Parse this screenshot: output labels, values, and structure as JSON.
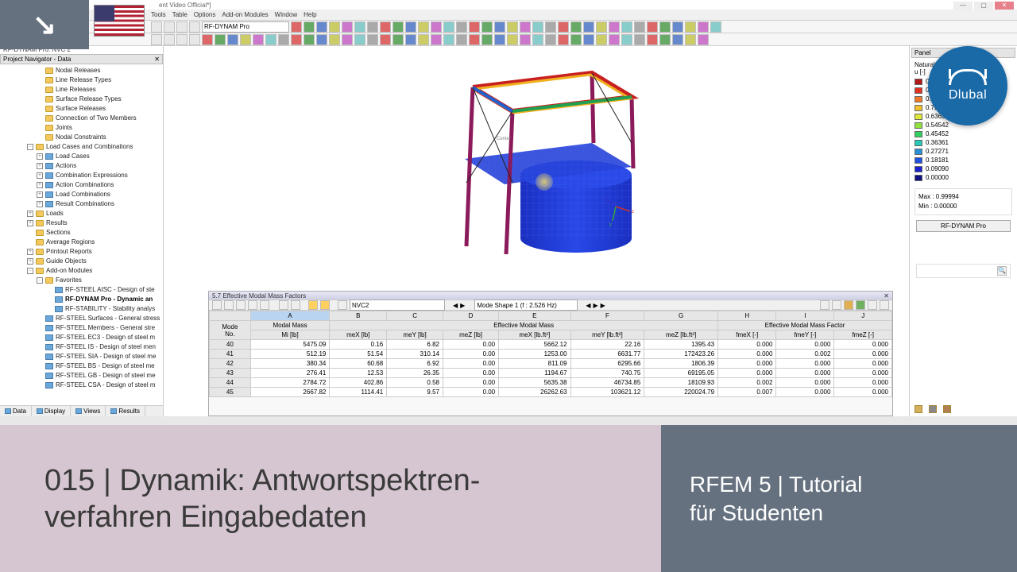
{
  "window": {
    "title_suffix": "ent Video Official*]"
  },
  "menus": [
    "Tools",
    "Table",
    "Options",
    "Add-on Modules",
    "Window",
    "Help"
  ],
  "toolbars": {
    "module_dropdown": "RF-DYNAM Pro",
    "icons_row1_count": 34,
    "icons_row2_count": 40
  },
  "navigator": {
    "context_title": "RF-DYNAM Pro: NVC 2",
    "panel_title": "Project Navigator - Data",
    "items": [
      {
        "ind": 40,
        "icon": "folder",
        "label": "Nodal Releases"
      },
      {
        "ind": 40,
        "icon": "folder",
        "label": "Line Release Types"
      },
      {
        "ind": 40,
        "icon": "folder",
        "label": "Line Releases"
      },
      {
        "ind": 40,
        "icon": "folder",
        "label": "Surface Release Types"
      },
      {
        "ind": 40,
        "icon": "folder",
        "label": "Surface Releases"
      },
      {
        "ind": 40,
        "icon": "folder",
        "label": "Connection of Two Members"
      },
      {
        "ind": 40,
        "icon": "folder",
        "label": "Joints"
      },
      {
        "ind": 40,
        "icon": "folder",
        "label": "Nodal Constraints"
      },
      {
        "ind": 28,
        "exp": "-",
        "icon": "folder",
        "label": "Load Cases and Combinations"
      },
      {
        "ind": 40,
        "exp": "+",
        "icon": "sq",
        "label": "Load Cases"
      },
      {
        "ind": 40,
        "exp": "+",
        "icon": "sq",
        "label": "Actions"
      },
      {
        "ind": 40,
        "exp": "+",
        "icon": "sq",
        "label": "Combination Expressions"
      },
      {
        "ind": 40,
        "exp": "+",
        "icon": "sq",
        "label": "Action Combinations"
      },
      {
        "ind": 40,
        "exp": "+",
        "icon": "sq",
        "label": "Load Combinations"
      },
      {
        "ind": 40,
        "exp": "+",
        "icon": "sq",
        "label": "Result Combinations"
      },
      {
        "ind": 28,
        "exp": "+",
        "icon": "folder",
        "label": "Loads"
      },
      {
        "ind": 28,
        "exp": "+",
        "icon": "folder",
        "label": "Results"
      },
      {
        "ind": 28,
        "icon": "folder",
        "label": "Sections"
      },
      {
        "ind": 28,
        "icon": "folder",
        "label": "Average Regions"
      },
      {
        "ind": 28,
        "exp": "+",
        "icon": "folder",
        "label": "Printout Reports"
      },
      {
        "ind": 28,
        "exp": "+",
        "icon": "folder",
        "label": "Guide Objects"
      },
      {
        "ind": 28,
        "exp": "-",
        "icon": "folder",
        "label": "Add-on Modules"
      },
      {
        "ind": 40,
        "exp": "-",
        "icon": "folder",
        "label": "Favorites"
      },
      {
        "ind": 52,
        "icon": "sq",
        "label": "RF-STEEL AISC - Design of ste"
      },
      {
        "ind": 52,
        "icon": "sq",
        "label": "RF-DYNAM Pro - Dynamic an",
        "bold": true
      },
      {
        "ind": 52,
        "icon": "sq",
        "label": "RF-STABILITY - Stability analys"
      },
      {
        "ind": 40,
        "icon": "sq",
        "label": "RF-STEEL Surfaces - General stress"
      },
      {
        "ind": 40,
        "icon": "sq",
        "label": "RF-STEEL Members - General stre"
      },
      {
        "ind": 40,
        "icon": "sq",
        "label": "RF-STEEL EC3 - Design of steel m"
      },
      {
        "ind": 40,
        "icon": "sq",
        "label": "RF-STEEL IS - Design of steel men"
      },
      {
        "ind": 40,
        "icon": "sq",
        "label": "RF-STEEL SIA - Design of steel me"
      },
      {
        "ind": 40,
        "icon": "sq",
        "label": "RF-STEEL BS - Design of steel me"
      },
      {
        "ind": 40,
        "icon": "sq",
        "label": "RF-STEEL GB - Design of steel me"
      },
      {
        "ind": 40,
        "icon": "sq",
        "label": "RF-STEEL CSA - Design of steel m"
      }
    ],
    "tabs": [
      "Data",
      "Display",
      "Views",
      "Results"
    ]
  },
  "legend": {
    "panel_label": "Panel",
    "title": "Natural vibration",
    "unit": "u [-]",
    "entries": [
      {
        "color": "#b21818",
        "value": "0.99994"
      },
      {
        "color": "#e03020",
        "value": "0.90903"
      },
      {
        "color": "#f07828",
        "value": "0.81813"
      },
      {
        "color": "#f0c030",
        "value": "0.72723"
      },
      {
        "color": "#e0e838",
        "value": "0.63632"
      },
      {
        "color": "#90e040",
        "value": "0.54542"
      },
      {
        "color": "#30d060",
        "value": "0.45452"
      },
      {
        "color": "#28c8b8",
        "value": "0.36361"
      },
      {
        "color": "#2890d8",
        "value": "0.27271"
      },
      {
        "color": "#2050e0",
        "value": "0.18181"
      },
      {
        "color": "#1820d0",
        "value": "0.09090"
      },
      {
        "color": "#101080",
        "value": "0.00000"
      }
    ],
    "max_label": "Max  :",
    "max": "0.99994",
    "min_label": "Min   :",
    "min": "0.00000",
    "button": "RF-DYNAM Pro"
  },
  "table": {
    "title": "5.7 Effective Modal Mass Factors",
    "nvc_dropdown": "NVC2",
    "mode_shape_label": "Mode Shape 1 (f : 2.526 Hz)",
    "col_letters": [
      "A",
      "B",
      "C",
      "D",
      "E",
      "F",
      "G",
      "H",
      "I",
      "J"
    ],
    "group_headers": {
      "g0_a": "Mode",
      "g0_b": "No.",
      "g1": "Modal Mass",
      "g1_b": "Mi [lb]",
      "g2": "Effective Modal Mass",
      "g3": "Effective Modal Mass Factor"
    },
    "sub_headers": [
      "meX [lb]",
      "meY [lb]",
      "meZ [lb]",
      "meX [lb.ft²]",
      "meY [lb.ft²]",
      "meZ [lb.ft²]",
      "fmeX [-]",
      "fmeY [-]",
      "fmeZ [-]"
    ],
    "rows": [
      {
        "no": "40",
        "mi": "5475.09",
        "mx": "0.16",
        "my": "6.82",
        "mz": "0.00",
        "rx": "5662.12",
        "ry": "22.16",
        "rz": "1395.43",
        "fx": "0.000",
        "fy": "0.000",
        "fz": "0.000"
      },
      {
        "no": "41",
        "mi": "512.19",
        "mx": "51.54",
        "my": "310.14",
        "mz": "0.00",
        "rx": "1253.00",
        "ry": "6631.77",
        "rz": "172423.26",
        "fx": "0.000",
        "fy": "0.002",
        "fz": "0.000"
      },
      {
        "no": "42",
        "mi": "380.34",
        "mx": "60.68",
        "my": "6.92",
        "mz": "0.00",
        "rx": "811.09",
        "ry": "6295.66",
        "rz": "1806.39",
        "fx": "0.000",
        "fy": "0.000",
        "fz": "0.000"
      },
      {
        "no": "43",
        "mi": "276.41",
        "mx": "12.53",
        "my": "26.35",
        "mz": "0.00",
        "rx": "1194.67",
        "ry": "740.75",
        "rz": "69195.05",
        "fx": "0.000",
        "fy": "0.000",
        "fz": "0.000"
      },
      {
        "no": "44",
        "mi": "2784.72",
        "mx": "402.86",
        "my": "0.58",
        "mz": "0.00",
        "rx": "5635.38",
        "ry": "46734.85",
        "rz": "18109.93",
        "fx": "0.002",
        "fy": "0.000",
        "fz": "0.000"
      },
      {
        "no": "45",
        "mi": "2667.82",
        "mx": "1114.41",
        "my": "9.57",
        "mz": "0.00",
        "rx": "26262.63",
        "ry": "103621.12",
        "rz": "220024.79",
        "fx": "0.007",
        "fy": "0.000",
        "fz": "0.000"
      }
    ]
  },
  "overlay": {
    "left_line1": "015 | Dynamik: Antwortspektren-",
    "left_line2": "verfahren Eingabedaten",
    "right_line1": "RFEM 5 | Tutorial",
    "right_line2": "für Studenten"
  },
  "logo": {
    "brand": "Dlubal"
  },
  "chart_data": {
    "type": "table",
    "title": "5.7 Effective Modal Mass Factors",
    "columns": [
      "Mode No.",
      "Modal Mass Mi [lb]",
      "meX [lb]",
      "meY [lb]",
      "meZ [lb]",
      "meX [lb.ft²]",
      "meY [lb.ft²]",
      "meZ [lb.ft²]",
      "fmeX [-]",
      "fmeY [-]",
      "fmeZ [-]"
    ],
    "rows": [
      [
        40,
        5475.09,
        0.16,
        6.82,
        0.0,
        5662.12,
        22.16,
        1395.43,
        0.0,
        0.0,
        0.0
      ],
      [
        41,
        512.19,
        51.54,
        310.14,
        0.0,
        1253.0,
        6631.77,
        172423.26,
        0.0,
        0.002,
        0.0
      ],
      [
        42,
        380.34,
        60.68,
        6.92,
        0.0,
        811.09,
        6295.66,
        1806.39,
        0.0,
        0.0,
        0.0
      ],
      [
        43,
        276.41,
        12.53,
        26.35,
        0.0,
        1194.67,
        740.75,
        69195.05,
        0.0,
        0.0,
        0.0
      ],
      [
        44,
        2784.72,
        402.86,
        0.58,
        0.0,
        5635.38,
        46734.85,
        18109.93,
        0.002,
        0.0,
        0.0
      ],
      [
        45,
        2667.82,
        1114.41,
        9.57,
        0.0,
        26262.63,
        103621.12,
        220024.79,
        0.007,
        0.0,
        0.0
      ]
    ]
  }
}
